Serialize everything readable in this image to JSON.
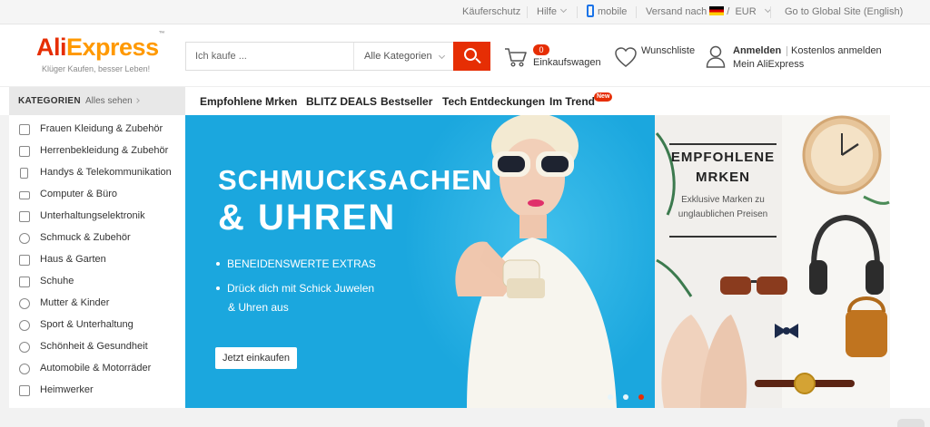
{
  "topbar": {
    "buyer_protection": "Käuferschutz",
    "help": "Hilfe",
    "mobile": "mobile",
    "ship_to": "Versand nach",
    "currency_sep": "/",
    "currency": "EUR",
    "global_site": "Go to Global Site (English)"
  },
  "header": {
    "logo_ali": "Ali",
    "logo_express": "Express",
    "logo_tm": "™",
    "tagline": "Klüger Kaufen, besser Leben!",
    "search_placeholder": "Ich kaufe ...",
    "category_select": "Alle Kategorien",
    "cart_count": "0",
    "cart_label": "Einkaufswagen",
    "wishlist_label": "Wunschliste",
    "sign_in": "Anmelden",
    "join": "Kostenlos anmelden",
    "my_account": "Mein AliExpress"
  },
  "nav": {
    "categories_title": "KATEGORIEN",
    "see_all": "Alles sehen",
    "links": [
      "Empfohlene Mrken",
      "BLITZ DEALS",
      "Bestseller",
      "Tech Entdeckungen",
      "Im Trend"
    ],
    "new_badge": "New"
  },
  "sidebar": {
    "items": [
      {
        "label": "Frauen Kleidung & Zubehör",
        "icon": "dress-icon"
      },
      {
        "label": "Herrenbekleidung & Zubehör",
        "icon": "shirt-icon"
      },
      {
        "label": "Handys & Telekommunikation",
        "icon": "phone-icon"
      },
      {
        "label": "Computer & Büro",
        "icon": "laptop-icon"
      },
      {
        "label": "Unterhaltungselektronik",
        "icon": "camera-icon"
      },
      {
        "label": "Schmuck & Zubehör",
        "icon": "ring-icon"
      },
      {
        "label": "Haus & Garten",
        "icon": "house-icon"
      },
      {
        "label": "Schuhe",
        "icon": "shoe-icon"
      },
      {
        "label": "Mutter & Kinder",
        "icon": "baby-icon"
      },
      {
        "label": "Sport & Unterhaltung",
        "icon": "ball-icon"
      },
      {
        "label": "Schönheit & Gesundheit",
        "icon": "lipstick-icon"
      },
      {
        "label": "Automobile & Motorräder",
        "icon": "wheel-icon"
      },
      {
        "label": "Heimwerker",
        "icon": "tools-icon"
      }
    ]
  },
  "banner": {
    "headline_1": "SCHMUCKSACHEN",
    "headline_2": "& UHREN",
    "bullet_1": "BENEIDENSWERTE EXTRAS",
    "bullet_2a": "Drück dich mit Schick Juwelen",
    "bullet_2b": "& Uhren aus",
    "cta": "Jetzt einkaufen",
    "active_slide": 3,
    "slides": 3
  },
  "promo": {
    "title_1": "EMPFOHLENE",
    "title_2": "MRKEN",
    "sub_1": "Exklusive Marken zu",
    "sub_2": "unglaublichen Preisen"
  },
  "colors": {
    "brand_red": "#e62e04",
    "brand_orange": "#ff9900",
    "banner_blue": "#1ba7de"
  }
}
